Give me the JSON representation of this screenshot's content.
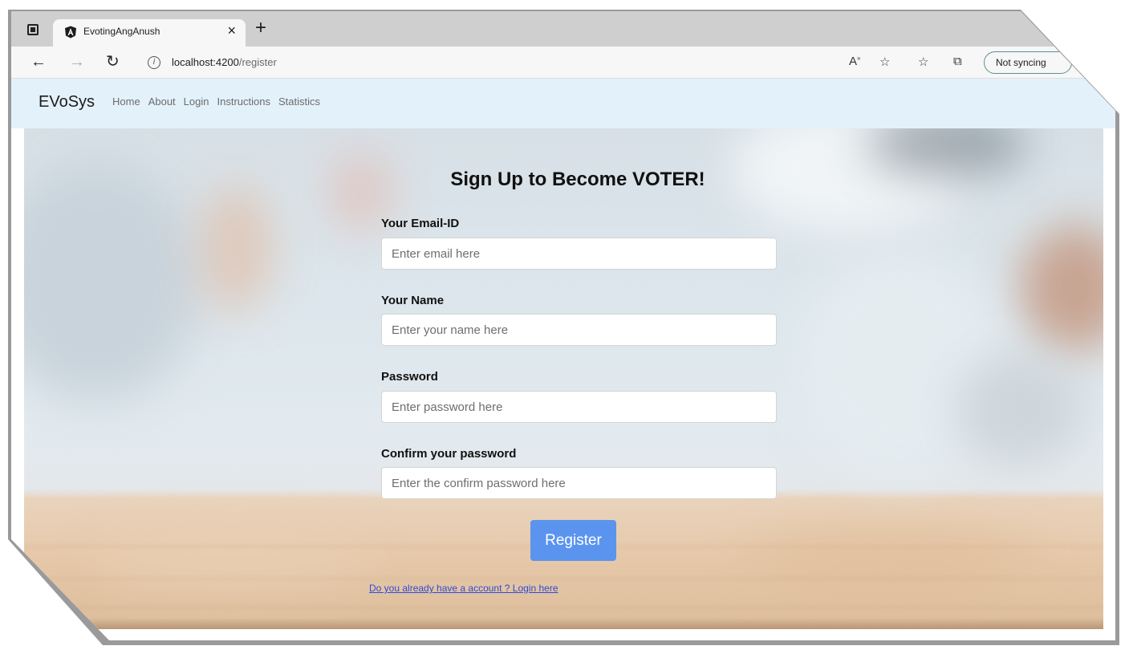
{
  "browser": {
    "tab_title": "EvotingAngAnush",
    "tab_close": "×",
    "new_tab": "+",
    "url_host": "localhost:4200",
    "url_path": "/register",
    "sync_label": "Not syncing"
  },
  "navbar": {
    "brand": "EVoSys",
    "links": [
      "Home",
      "About",
      "Login",
      "Instructions",
      "Statistics"
    ]
  },
  "form": {
    "title": "Sign Up to Become VOTER!",
    "email_label": "Your Email-ID",
    "email_placeholder": "Enter email here",
    "name_label": "Your Name",
    "name_placeholder": "Enter your name here",
    "password_label": "Password",
    "password_placeholder": "Enter password here",
    "confirm_label": "Confirm your password",
    "confirm_placeholder": "Enter the confirm password here",
    "register_label": "Register",
    "login_link": "Do you already have a account ? Login here"
  },
  "colors": {
    "navbar_bg": "#e3f1fb",
    "button_bg": "#5b94ef",
    "link": "#2f4bd6"
  }
}
